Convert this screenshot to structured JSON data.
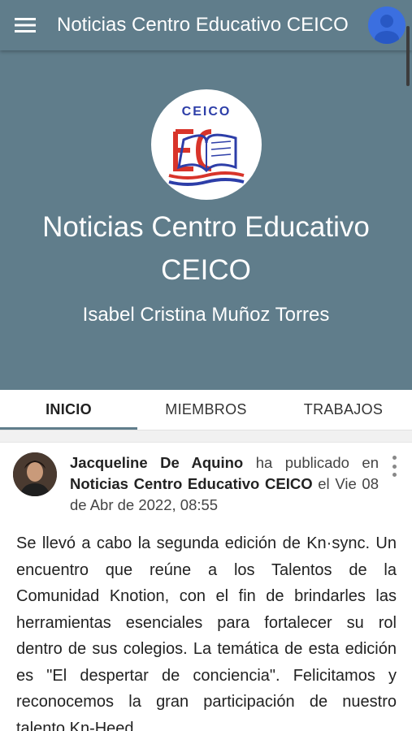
{
  "appbar": {
    "title": "Noticias Centro Educativo CEICO",
    "menu_icon": "hamburger-menu-icon",
    "profile_icon": "user-avatar-icon"
  },
  "hero": {
    "logo_text": "CEICO",
    "title": "Noticias Centro Educativo CEICO",
    "subtitle": "Isabel Cristina Muñoz Torres",
    "background_color": "#607d8b"
  },
  "tabs": [
    {
      "label": "INICIO",
      "active": true
    },
    {
      "label": "MIEMBROS",
      "active": false
    },
    {
      "label": "TRABAJOS",
      "active": false
    }
  ],
  "post": {
    "author": "Jacqueline De Aquino",
    "action": "ha publicado en",
    "group": "Noticias Centro Educativo CEICO",
    "preposition": "el",
    "date": "Vie 08 de Abr de 2022, 08:55",
    "body": "Se llevó a cabo la segunda edición de Kn·sync. Un encuentro que reúne a los Talentos de la Comunidad Knotion, con el fin de brindarles las herramientas esenciales para fortalecer su rol dentro de sus colegios. La temática de esta edición es \"El despertar de conciencia\". Felicitamos y reconocemos la gran participación de nuestro talento Kn-Heed"
  }
}
